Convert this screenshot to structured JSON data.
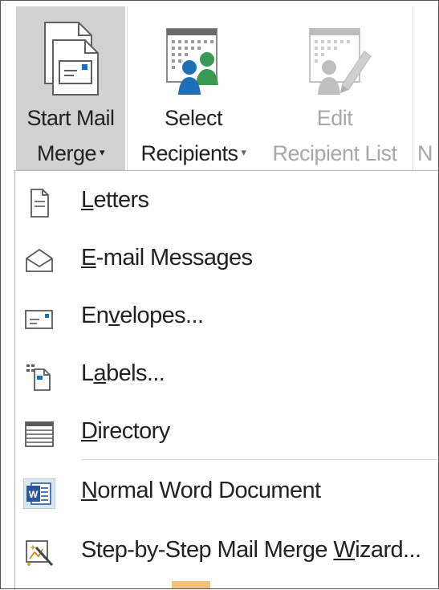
{
  "ribbon": {
    "start_mail_merge": {
      "line1": "Start Mail",
      "line2": "Merge",
      "caret": "▾",
      "icon": "document-letter-icon"
    },
    "select_recipients": {
      "line1": "Select",
      "line2": "Recipients",
      "caret": "▾",
      "icon": "recipients-grid-icon"
    },
    "edit_recipient_list": {
      "line1": "Edit",
      "line2": "Recipient List",
      "icon": "edit-recipients-icon"
    },
    "next_partial": {
      "line2": "N"
    }
  },
  "menu": {
    "items": [
      {
        "pre": "",
        "ul": "L",
        "post": "etters",
        "icon": "letter-page-icon"
      },
      {
        "pre": "",
        "ul": "E",
        "post": "-mail Messages",
        "icon": "email-envelope-icon"
      },
      {
        "pre": "En",
        "ul": "v",
        "post": "elopes...",
        "icon": "envelope-card-icon"
      },
      {
        "pre": "L",
        "ul": "a",
        "post": "bels...",
        "icon": "labels-icon"
      },
      {
        "pre": "",
        "ul": "D",
        "post": "irectory",
        "icon": "directory-list-icon"
      },
      {
        "pre": "",
        "ul": "N",
        "post": "ormal Word Document",
        "icon": "word-document-icon"
      },
      {
        "pre": "Step-by-Step Mail Merge ",
        "ul": "W",
        "post": "izard...",
        "icon": "wizard-wand-icon"
      }
    ]
  },
  "colors": {
    "selected_button_bg": "#d2d2d2",
    "disabled_text": "#a8a8a8",
    "word_blue": "#2b579a",
    "person_blue": "#1f6fb7",
    "person_green": "#3a9a54"
  }
}
